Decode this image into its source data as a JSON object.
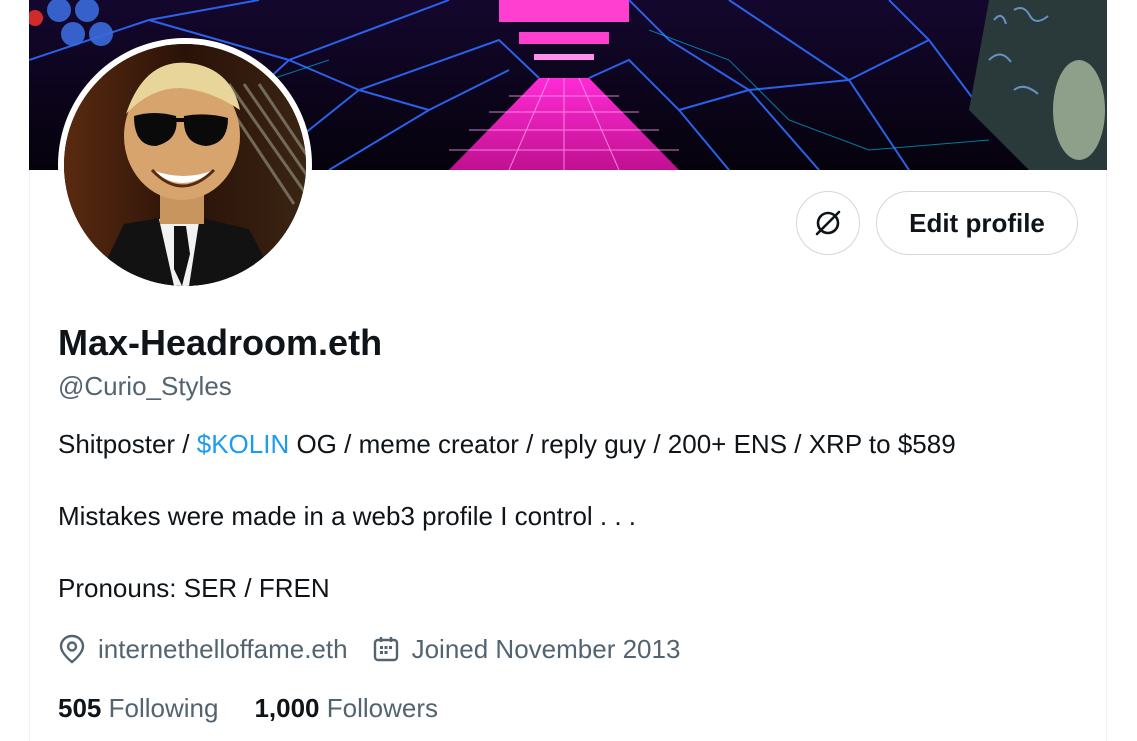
{
  "profile": {
    "display_name": "Max-Headroom.eth",
    "handle": "@Curio_Styles",
    "bio": {
      "line1_pre": "Shitposter / ",
      "line1_link": "$KOLIN",
      "line1_post": " OG / meme creator / reply guy / 200+ ENS / XRP to $589",
      "line2": "Mistakes were made in a web3 profile I control . . .",
      "line3": "Pronouns: SER / FREN"
    },
    "location": "internethelloffame.eth",
    "joined": "Joined November 2013",
    "following_count": "505",
    "following_label": " Following",
    "followers_count": "1,000",
    "followers_label": " Followers"
  },
  "actions": {
    "edit_profile_label": "Edit profile",
    "more_icon": "no-sign-icon"
  },
  "colors": {
    "text_primary": "#0f1419",
    "text_secondary": "#536471",
    "link": "#1d9bf0",
    "border": "#cfd9de"
  }
}
